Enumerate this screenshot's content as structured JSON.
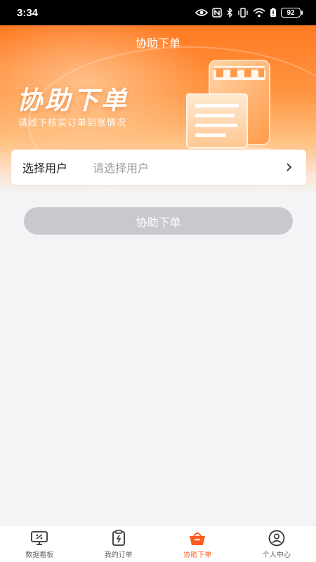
{
  "status_bar": {
    "time": "3:34",
    "battery": "92",
    "icons": [
      "eye-icon",
      "nfc-icon",
      "bluetooth-icon",
      "vibrate-icon",
      "wifi-icon",
      "battery-saver-icon",
      "battery-icon"
    ]
  },
  "header": {
    "title": "协助下单"
  },
  "hero": {
    "title": "协助下单",
    "subtitle": "请线下核实订单到账情况",
    "illustration_icon": "phone-receipt-icon"
  },
  "form": {
    "user_label": "选择用户",
    "user_placeholder": "请选择用户"
  },
  "submit_label": "协助下单",
  "tabbar": {
    "tabs": [
      {
        "label": "数据看板",
        "icon": "dashboard-icon",
        "active": false
      },
      {
        "label": "我的订单",
        "icon": "clipboard-icon",
        "active": false
      },
      {
        "label": "协助下单",
        "icon": "basket-icon",
        "active": true
      },
      {
        "label": "个人中心",
        "icon": "user-icon",
        "active": false
      }
    ]
  },
  "colors": {
    "accent": "#ff5a1f",
    "banner": "#ff7a22",
    "button_disabled": "#c7c9ce",
    "background": "#f3f4f6"
  }
}
